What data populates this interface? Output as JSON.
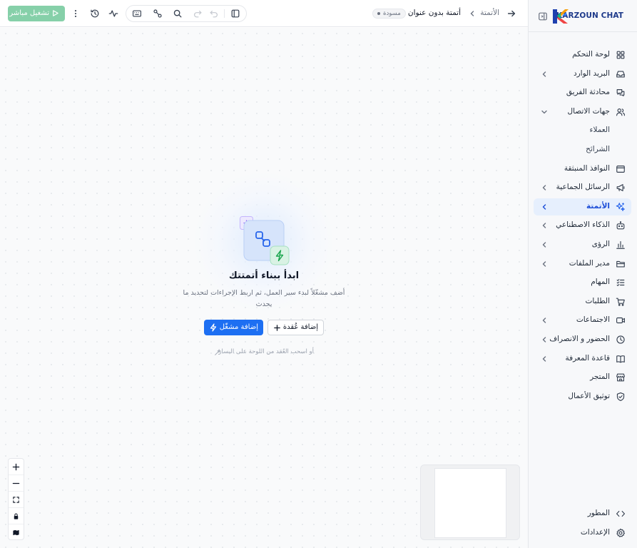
{
  "brand": {
    "name": "KARZOUN CHAT"
  },
  "sidebar": {
    "items": [
      {
        "id": "dashboard",
        "label": "لوحة التحكم",
        "icon": "grid-icon",
        "chevron": false
      },
      {
        "id": "inbox",
        "label": "البريد الوارد",
        "icon": "inbox-icon",
        "chevron": true
      },
      {
        "id": "team-chat",
        "label": "محادثة الفريق",
        "icon": "chat-icon",
        "chevron": false
      },
      {
        "id": "contacts",
        "label": "جهات الاتصال",
        "icon": "users-icon",
        "chevron": true,
        "expanded": true
      },
      {
        "id": "customers",
        "label": "العملاء",
        "sub": true
      },
      {
        "id": "segments",
        "label": "الشرائح",
        "sub": true
      },
      {
        "id": "popups",
        "label": "النوافذ المنبثقة",
        "icon": "window-icon",
        "chevron": false
      },
      {
        "id": "broadcasts",
        "label": "الرسائل الجماعية",
        "icon": "megaphone-icon",
        "chevron": true
      },
      {
        "id": "automation",
        "label": "الأتمتة",
        "icon": "sparkles-icon",
        "chevron": true,
        "active": true
      },
      {
        "id": "ai",
        "label": "الذكاء الاصطناعي",
        "icon": "bot-icon",
        "chevron": true
      },
      {
        "id": "insights",
        "label": "الرؤى",
        "icon": "bar-chart-icon",
        "chevron": true
      },
      {
        "id": "file-manager",
        "label": "مدير الملفات",
        "icon": "folder-icon",
        "chevron": true
      },
      {
        "id": "tasks",
        "label": "المهام",
        "icon": "checklist-icon",
        "chevron": false
      },
      {
        "id": "orders",
        "label": "الطلبات",
        "icon": "cart-icon",
        "chevron": false
      },
      {
        "id": "meetings",
        "label": "الاجتماعات",
        "icon": "video-icon",
        "chevron": true
      },
      {
        "id": "attendance",
        "label": "الحضور و الانصراف",
        "icon": "clock-icon",
        "chevron": true
      },
      {
        "id": "knowledge-base",
        "label": "قاعدة المعرفة",
        "icon": "book-icon",
        "chevron": true
      },
      {
        "id": "store",
        "label": "المتجر",
        "icon": "store-icon",
        "chevron": false
      },
      {
        "id": "business-verify",
        "label": "توثيق الأعمال",
        "icon": "shield-check-icon",
        "chevron": false
      }
    ],
    "footer": [
      {
        "id": "developer",
        "label": "المطور",
        "icon": "code-icon"
      },
      {
        "id": "settings",
        "label": "الإعدادات",
        "icon": "gear-icon"
      }
    ]
  },
  "topbar": {
    "breadcrumb_root": "الأتمتة",
    "title": "أتمتة بدون عنوان",
    "status_badge": "مسودة",
    "run_label": "تشغيل مباشر",
    "icons": [
      "panel-icon",
      "undo-icon",
      "redo-icon",
      "search-icon",
      "connections-icon",
      "keyboard-icon",
      "activity-icon",
      "history-icon",
      "more-vertical-icon"
    ]
  },
  "canvas": {
    "empty_title": "ابدأ ببناء أتمتتك",
    "empty_desc": "أضف مشغّلاً لبدء سير العمل، ثم اربط الإجراءات لتحديد ما يحدث",
    "add_trigger_label": "إضافة مشغّل",
    "add_node_label": "إضافة عُقدة",
    "hint": "أو اسحب العُقد من اللوحة على اليسار",
    "zoom_controls": [
      "zoom-in-icon",
      "zoom-out-icon",
      "fit-view-icon",
      "lock-icon",
      "map-icon"
    ]
  },
  "colors": {
    "accent": "#1d6ff2",
    "active_bg": "#e6effd",
    "run_button": "#86d0a9",
    "trigger_green": "#22a565"
  }
}
